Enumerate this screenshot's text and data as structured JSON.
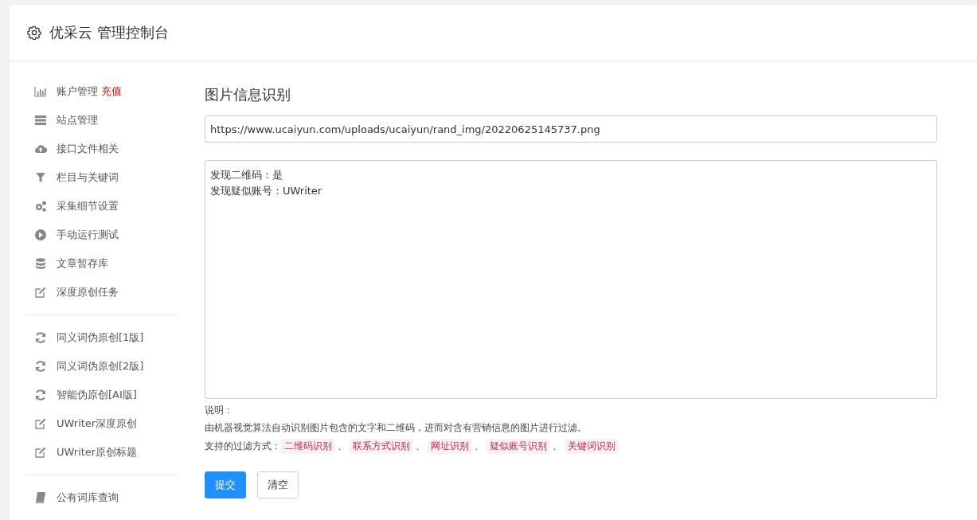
{
  "header": {
    "title": "优采云 管理控制台"
  },
  "sidebar": {
    "groups": [
      {
        "items": [
          {
            "kind": "chart",
            "label": "账户管理",
            "badge": "充值"
          },
          {
            "kind": "server",
            "label": "站点管理"
          },
          {
            "kind": "cloud",
            "label": "接口文件相关"
          },
          {
            "kind": "filter",
            "label": "栏目与关键词"
          },
          {
            "kind": "gears",
            "label": "采集细节设置"
          },
          {
            "kind": "play",
            "label": "手动运行测试"
          },
          {
            "kind": "database",
            "label": "文章暂存库"
          },
          {
            "kind": "edit",
            "label": "深度原创任务"
          }
        ]
      },
      {
        "items": [
          {
            "kind": "refresh",
            "label": "同义词伪原创[1版]"
          },
          {
            "kind": "refresh",
            "label": "同义词伪原创[2版]"
          },
          {
            "kind": "refresh",
            "label": "智能伪原创[AI版]"
          },
          {
            "kind": "edit",
            "label": "UWriter深度原创"
          },
          {
            "kind": "edit",
            "label": "UWriter原创标题"
          }
        ]
      },
      {
        "items": [
          {
            "kind": "book",
            "label": "公有词库查询"
          }
        ]
      }
    ]
  },
  "main": {
    "title": "图片信息识别",
    "url_field": {
      "value": "https://www.ucaiyun.com/uploads/ucaiyun/rand_img/20220625145737.png"
    },
    "result_field": {
      "lines": [
        "发现二维码：是",
        "发现疑似账号：UWriter"
      ]
    },
    "note_heading": "说明：",
    "note_text": "由机器视觉算法自动识别图片包含的文字和二维码，进而对含有营销信息的图片进行过滤。",
    "filter_label": "支持的过滤方式：",
    "filters": [
      "二维码识别",
      "联系方式识别",
      "网址识别",
      "疑似账号识别",
      "关键词识别"
    ],
    "filter_separator": "、",
    "buttons": [
      {
        "kind": "primary",
        "label": "提交"
      },
      {
        "kind": "default",
        "label": "清空"
      }
    ]
  }
}
